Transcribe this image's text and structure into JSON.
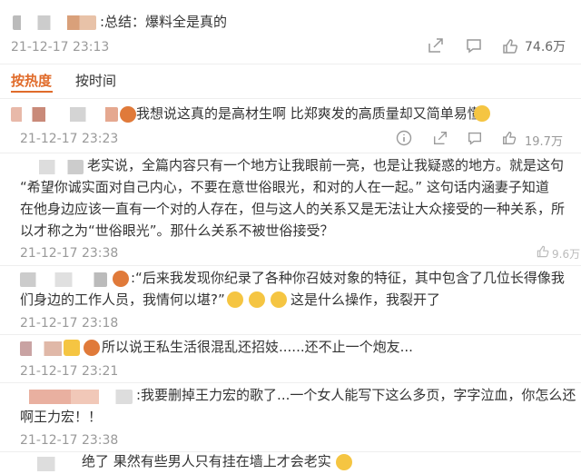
{
  "post": {
    "text": ":总结：爆料全是真的",
    "time": "21-12-17 23:13",
    "likes": "74.6万"
  },
  "tabs": {
    "hot": "按热度",
    "time": "按时间"
  },
  "comments": [
    {
      "text": "我想说这真的是高材生啊 比郑爽发的高质量却又简单易懂",
      "time": "21-12-17 23:23",
      "likes": "19.7万"
    },
    {
      "line1": "老实说，全篇内容只有一个地方让我眼前一亮，也是让我疑惑的地方。就是这句",
      "line2": "“希望你诚实面对自己内心，不要在意世俗眼光，和对的人在一起。” 这句话内涵妻子知道",
      "line3": "在他身边应该一直有一个对的人存在，但与这人的关系又是无法让大众接受的一种关系，所",
      "line4": "以才称之为“世俗眼光”。那什么关系不被世俗接受？",
      "time": "21-12-17 23:38",
      "likes": "9.6万"
    },
    {
      "line1": ":“后来我发现你纪录了各种你召妓对象的特征，其中包含了几位长得像我",
      "line2": "们身边的工作人员，我情何以堪?”",
      "line2b": "这是什么操作，我裂开了",
      "time": "21-12-17 23:18"
    },
    {
      "text": "所以说王私生活很混乱还招妓......还不止一个炮友...",
      "time": "21-12-17 23:21"
    },
    {
      "line1": ":我要删掉王力宏的歌了...一个女人能写下这么多页，字字泣血，你怎么还",
      "line2": "啊王力宏！！",
      "time": "21-12-17 23:38"
    },
    {
      "text": "绝了 果然有些男人只有挂在墙上才会老实"
    }
  ]
}
